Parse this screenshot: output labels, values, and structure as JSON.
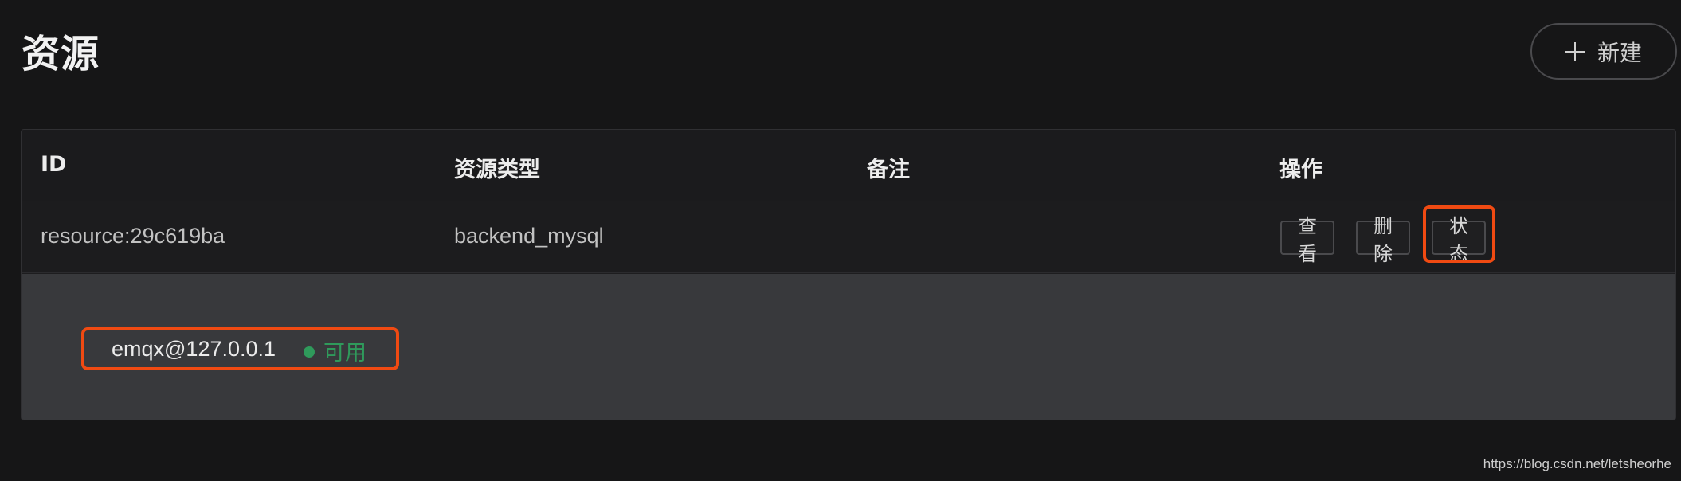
{
  "page": {
    "title": "资源"
  },
  "toolbar": {
    "new_label": "新建",
    "new_icon": "plus-icon"
  },
  "table": {
    "headers": [
      "ID",
      "资源类型",
      "备注",
      "操作"
    ],
    "rows": [
      {
        "id": "resource:29c619ba",
        "type": "backend_mysql",
        "remark": "",
        "actions": [
          "查看",
          "删除",
          "状态"
        ]
      }
    ],
    "expanded": {
      "node": "emqx@127.0.0.1",
      "status": "可用",
      "status_color": "#2f9a5b"
    }
  },
  "highlight_color": "#f04a12",
  "watermark": "https://blog.csdn.net/letsheorhe"
}
